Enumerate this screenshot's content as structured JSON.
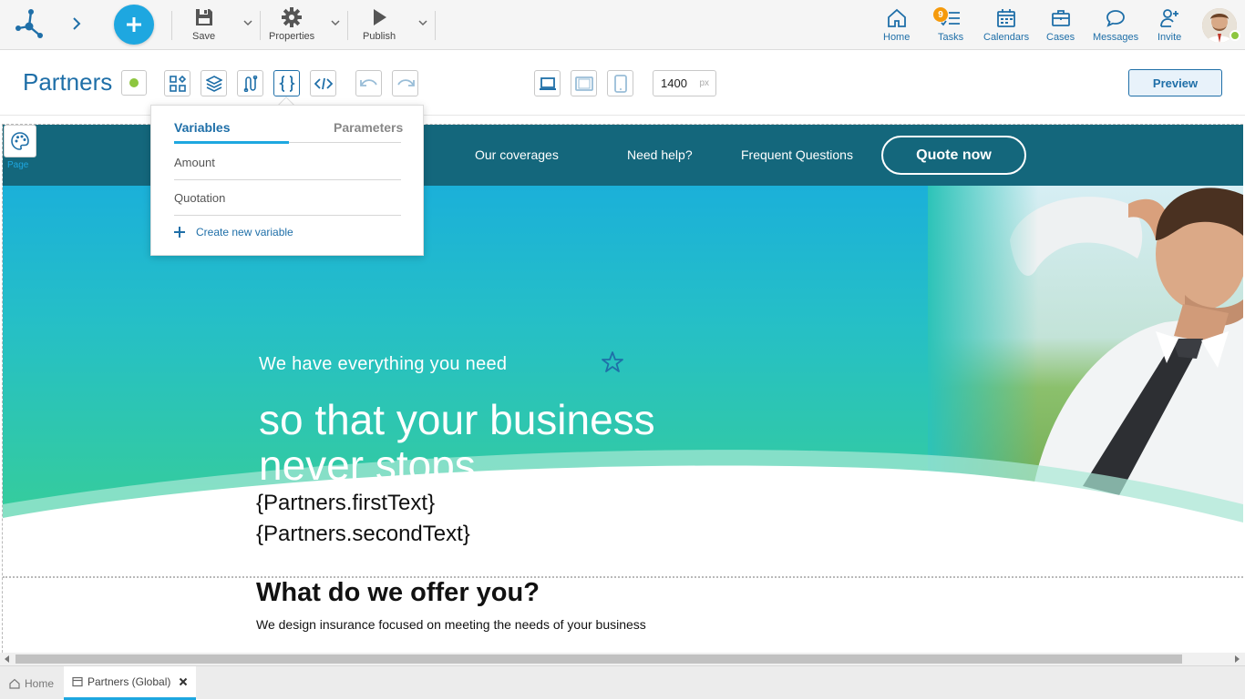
{
  "topbar": {
    "tools": [
      {
        "label": "Save",
        "icon": "save-icon"
      },
      {
        "label": "Properties",
        "icon": "gear-icon"
      },
      {
        "label": "Publish",
        "icon": "play-icon"
      }
    ],
    "nav": [
      {
        "label": "Home",
        "icon": "home-icon"
      },
      {
        "label": "Tasks",
        "icon": "tasks-icon"
      },
      {
        "label": "Calendars",
        "icon": "calendar-icon"
      },
      {
        "label": "Cases",
        "icon": "briefcase-icon"
      },
      {
        "label": "Messages",
        "icon": "chat-icon"
      },
      {
        "label": "Invite",
        "icon": "invite-icon"
      }
    ],
    "tasks_badge": "9"
  },
  "editor": {
    "title": "Partners",
    "width_value": "1400",
    "width_unit": "px",
    "preview_label": "Preview"
  },
  "popover": {
    "tab_variables": "Variables",
    "tab_parameters": "Parameters",
    "items": [
      "Amount",
      "Quotation"
    ],
    "create_label": "Create new variable"
  },
  "canvas": {
    "page_tool_label": "Page",
    "nav_links": [
      "Our coverages",
      "Need help?",
      "Frequent Questions"
    ],
    "quote_button": "Quote now",
    "hero_subtitle": "We have everything you need",
    "hero_title_line1": "so that your business",
    "hero_title_line2": "never stops",
    "var_first": "{Partners.firstText}",
    "var_second": "{Partners.secondText}",
    "offer_title": "What do we offer you?",
    "offer_text": "We design insurance focused on meeting the needs of your business"
  },
  "bottom_tabs": [
    {
      "label": "Home",
      "icon": "home-icon"
    },
    {
      "label": "Partners (Global)",
      "icon": "page-icon"
    }
  ],
  "colors": {
    "accent": "#1ea7e0",
    "primary_text": "#1f6fa8",
    "site_nav": "#14677c",
    "status_green": "#8dc63f",
    "badge_orange": "#f59a0c"
  }
}
